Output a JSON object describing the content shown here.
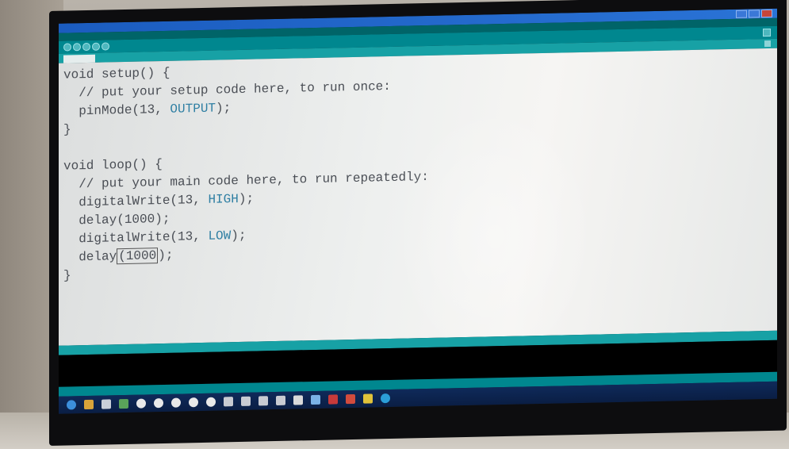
{
  "window": {
    "title": "",
    "menu": ""
  },
  "tab": {
    "label": ""
  },
  "code": {
    "l1": "void setup() {",
    "l2": "  // put your setup code here, to run once:",
    "l3a": "  pinMode(13, ",
    "l3b": "OUTPUT",
    "l3c": ");",
    "l4": "}",
    "l5": "",
    "l6": "void loop() {",
    "l7": "  // put your main code here, to run repeatedly:",
    "l8a": "  digitalWrite(13, ",
    "l8b": "HIGH",
    "l8c": ");",
    "l9": "  delay(1000);",
    "l10a": "  digitalWrite(13, ",
    "l10b": "LOW",
    "l10c": ");",
    "l11a": "  delay",
    "l11b": "(1000",
    "l11c": ");",
    "l12": "}"
  },
  "colors": {
    "toolbar": "#00878f",
    "tabbar": "#17a1a5",
    "titlebar": "#1b5cbf",
    "taskbar": "#0f2a5a"
  },
  "icons": [
    "verify-icon",
    "upload-icon",
    "new-icon",
    "open-icon",
    "save-icon",
    "serial-monitor-icon"
  ]
}
